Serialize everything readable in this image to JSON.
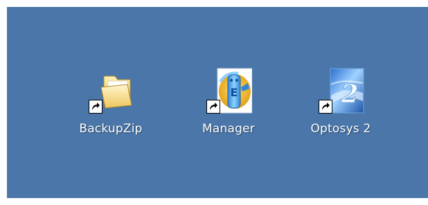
{
  "desktop": {
    "background_color": "#4a76a9",
    "icons": [
      {
        "label": "BackupZip",
        "icon": "folder-icon",
        "shortcut_overlay": "shortcut-arrow-icon"
      },
      {
        "label": "Manager",
        "icon": "manager-app-icon",
        "shortcut_overlay": "shortcut-arrow-icon"
      },
      {
        "label": "Optosys 2",
        "icon": "optosys-app-icon",
        "shortcut_overlay": "shortcut-arrow-icon"
      }
    ]
  }
}
